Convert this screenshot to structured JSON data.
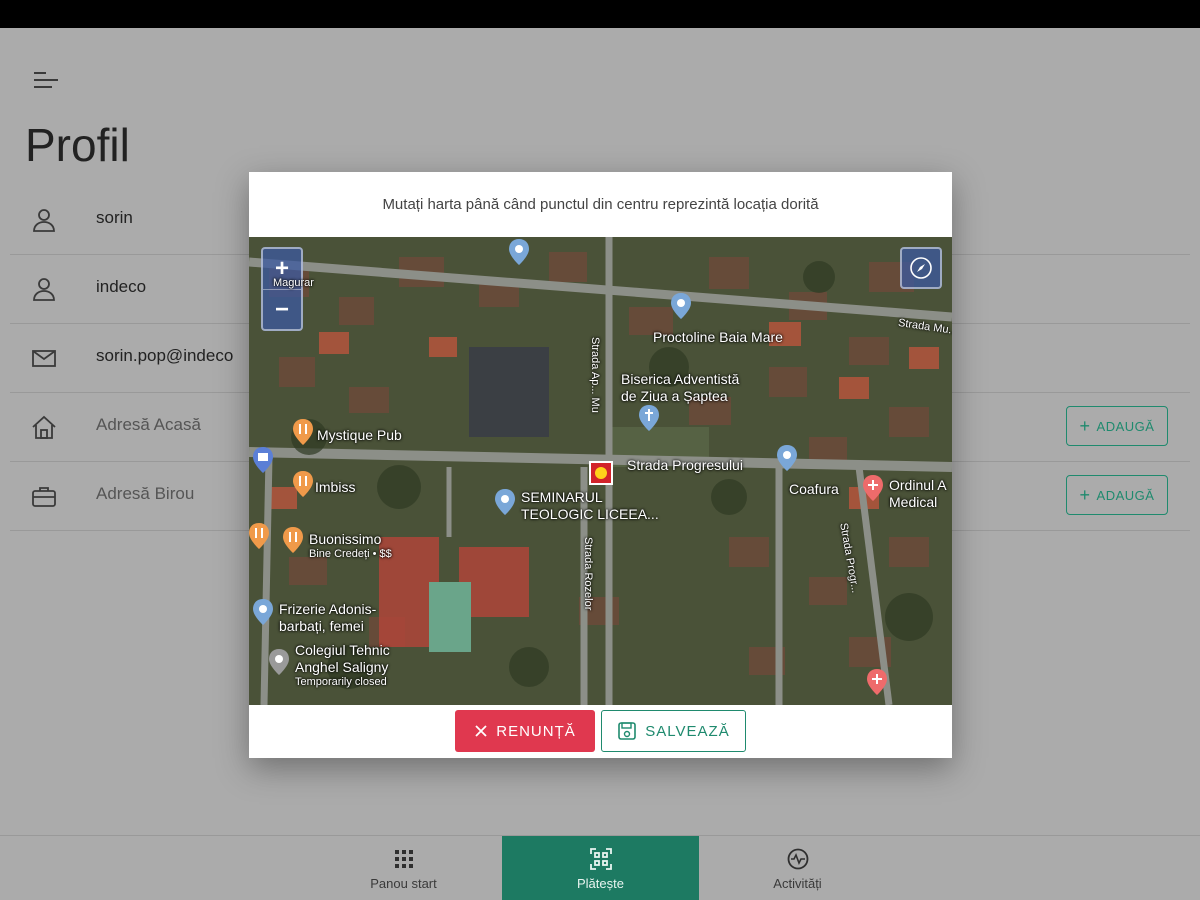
{
  "page": {
    "title": "Profil"
  },
  "profile": {
    "rows": [
      {
        "icon": "person-icon",
        "text": "sorin"
      },
      {
        "icon": "person-icon",
        "text": "indeco"
      },
      {
        "icon": "email-icon",
        "text": "sorin.pop@indeco"
      },
      {
        "icon": "home-icon",
        "text": "Adresă Acasă",
        "button": "ADAUGĂ"
      },
      {
        "icon": "briefcase-icon",
        "text": "Adresă Birou",
        "button": "ADAUGĂ"
      }
    ]
  },
  "dialog": {
    "message": "Mutați harta până când punctul din centru reprezintă locația dorită",
    "cancel_label": "RENUNȚĂ",
    "save_label": "SALVEAZĂ",
    "zoom_in": "+",
    "zoom_out": "−"
  },
  "map": {
    "labels": [
      "Mystique Pub",
      "Imbiss",
      "Buonissimo",
      "Bine Credeți • $$",
      "Frizerie Adonis-",
      "barbați, femei",
      "Colegiul Tehnic",
      "Anghel Saligny",
      "Temporarily closed",
      "SEMINARUL",
      "TEOLOGIC LICEEA...",
      "Strada Progresului",
      "Coafura",
      "Ordinul A",
      "Medical",
      "Proctoline Baia Mare",
      "Biserica Adventistă",
      "de Ziua a Șaptea",
      "Strada Ap... Mu",
      "Strada Rozelor",
      "Strada Progr...",
      "Strada Mu...",
      "Magurar"
    ]
  },
  "nav": {
    "items": [
      {
        "label": "Panou start",
        "icon": "grid-icon"
      },
      {
        "label": "Plătește",
        "icon": "qr-scan-icon"
      },
      {
        "label": "Activități",
        "icon": "activity-icon"
      }
    ]
  },
  "colors": {
    "accent": "#1d7a62",
    "cancel": "#e0384f",
    "overlay": "#ababab"
  }
}
